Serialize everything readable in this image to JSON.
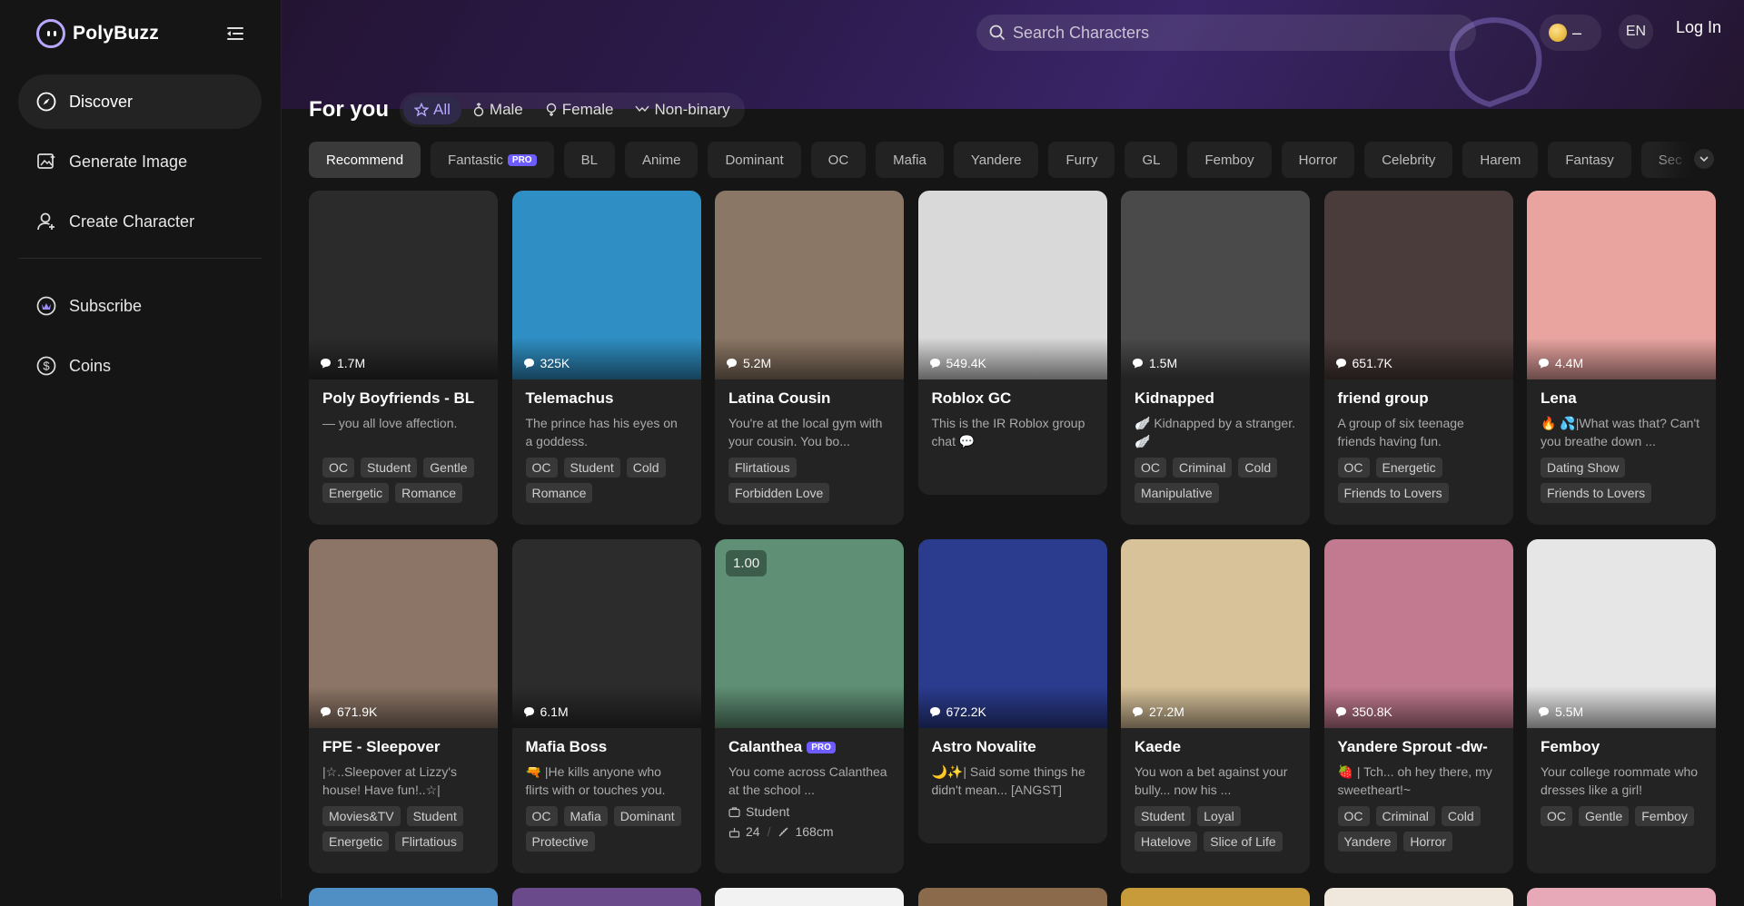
{
  "app": {
    "name": "PolyBuzz"
  },
  "sidebar": {
    "items": [
      {
        "label": "Discover",
        "icon": "compass-icon"
      },
      {
        "label": "Generate Image",
        "icon": "image-sparkle-icon"
      },
      {
        "label": "Create Character",
        "icon": "add-user-icon"
      },
      {
        "label": "Subscribe",
        "icon": "crown-icon"
      },
      {
        "label": "Coins",
        "icon": "dollar-coin-icon"
      }
    ]
  },
  "header": {
    "search_placeholder": "Search Characters",
    "coins_value": "–",
    "language": "EN",
    "login_label": "Log In"
  },
  "for_you": {
    "title": "For you",
    "genders": [
      "All",
      "Male",
      "Female",
      "Non-binary"
    ]
  },
  "categories": [
    "Recommend",
    "Fantastic",
    "BL",
    "Anime",
    "Dominant",
    "OC",
    "Mafia",
    "Yandere",
    "Furry",
    "GL",
    "Femboy",
    "Horror",
    "Celebrity",
    "Harem",
    "Fantasy",
    "Sec"
  ],
  "pro_label": "PRO",
  "cards": [
    {
      "name": "Poly Boyfriends - BL",
      "count": "1.7M",
      "desc": "— you all love affection.",
      "tags": [
        "OC",
        "Student",
        "Gentle",
        "Energetic",
        "Romance"
      ],
      "bg": "#2b2b2b"
    },
    {
      "name": "Telemachus",
      "count": "325K",
      "desc": "The prince has his eyes on a goddess.",
      "tags": [
        "OC",
        "Student",
        "Cold",
        "Romance"
      ],
      "bg": "#2f8fc4"
    },
    {
      "name": "Latina Cousin",
      "count": "5.2M",
      "desc": "You're at the local gym with your cousin. You bo...",
      "tags": [
        "Flirtatious",
        "Forbidden Love"
      ],
      "bg": "#8b7765"
    },
    {
      "name": "Roblox GC",
      "count": "549.4K",
      "desc": "This is the IR Roblox group chat 💬",
      "tags": [],
      "bg": "#d9d9d9"
    },
    {
      "name": "Kidnapped",
      "count": "1.5M",
      "desc": "🪽 Kidnapped by a stranger. 🪽",
      "tags": [
        "OC",
        "Criminal",
        "Cold",
        "Manipulative"
      ],
      "bg": "#4a4a4a"
    },
    {
      "name": "friend group",
      "count": "651.7K",
      "desc": "A group of six teenage friends having fun.",
      "tags": [
        "OC",
        "Energetic",
        "Friends to Lovers"
      ],
      "bg": "#4a3c3a"
    },
    {
      "name": "Lena",
      "count": "4.4M",
      "desc": "🔥 💦|What was that? Can't you breathe down ...",
      "tags": [
        "Dating Show",
        "Friends to Lovers"
      ],
      "bg": "#e9a4a0"
    },
    {
      "name": "FPE - Sleepover",
      "count": "671.9K",
      "desc": "|☆..Sleepover at Lizzy's house! Have fun!..☆|",
      "tags": [
        "Movies&TV",
        "Student",
        "Energetic",
        "Flirtatious"
      ],
      "bg": "#8c7566"
    },
    {
      "name": "Mafia Boss",
      "count": "6.1M",
      "desc": "🔫 |He kills anyone who flirts with or touches you.",
      "tags": [
        "OC",
        "Mafia",
        "Dominant",
        "Protective"
      ],
      "bg": "#2c2c2c"
    },
    {
      "name": "Calanthea",
      "count": "",
      "desc": "You come across Calanthea at the school ...",
      "tags": [],
      "bg": "#5f8f74",
      "pro": true,
      "role": "Student",
      "age": "24",
      "height": "168cm",
      "badge": "1.00"
    },
    {
      "name": "Astro Novalite",
      "count": "672.2K",
      "desc": "🌙✨| Said some things he didn't mean... [ANGST]",
      "tags": [],
      "bg": "#2b3c8f"
    },
    {
      "name": "Kaede",
      "count": "27.2M",
      "desc": "You won a bet against your bully... now his ...",
      "tags": [
        "Student",
        "Loyal",
        "Hatelove",
        "Slice of Life"
      ],
      "bg": "#d8c29a"
    },
    {
      "name": "Yandere Sprout -dw-",
      "count": "350.8K",
      "desc": "🍓 | Tch... oh hey there, my sweetheart!~",
      "tags": [
        "OC",
        "Criminal",
        "Cold",
        "Yandere",
        "Horror"
      ],
      "bg": "#c27a90"
    },
    {
      "name": "Femboy",
      "count": "5.5M",
      "desc": "Your college roommate who dresses like a girl!",
      "tags": [
        "OC",
        "Gentle",
        "Femboy"
      ],
      "bg": "#e6e6e6"
    }
  ],
  "row3_colors": [
    "#4f8fc4",
    "#6a4a8a",
    "#f2f2f2",
    "#8a6a4a",
    "#c79a3a",
    "#f0e8dc",
    "#e7a9b8"
  ]
}
